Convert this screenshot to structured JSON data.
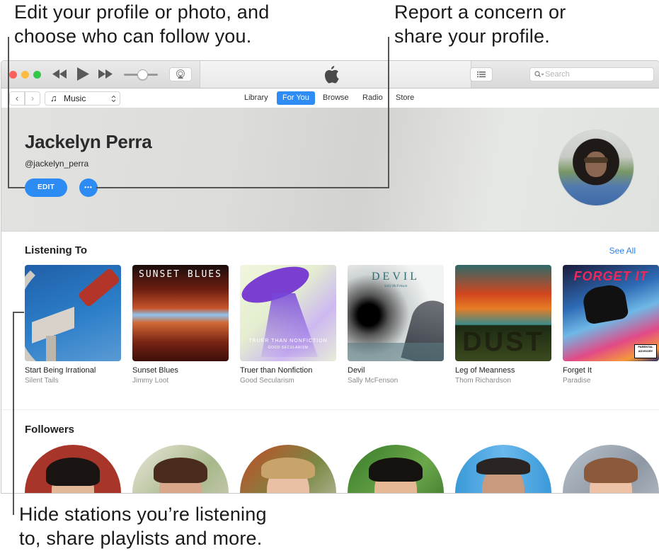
{
  "callouts": {
    "top_left": [
      "Edit your profile or photo, and",
      "choose who can follow you."
    ],
    "top_right": [
      "Report a concern or",
      "share your profile."
    ],
    "bottom": [
      "Hide stations you’re listening",
      "to, share playlists and more."
    ]
  },
  "toolbar": {
    "rewind_icon": "⏪",
    "play_icon": "▶",
    "forward_icon": "⏩",
    "volume_level": 0.55,
    "list_icon": "☰",
    "search_icon": "⌕",
    "search_placeholder": "Search",
    "apple_logo": ""
  },
  "navbar": {
    "back_icon": "‹",
    "forward_icon": "›",
    "source_icon": "♫",
    "source_label": "Music",
    "source_chevron": "⬍",
    "tabs": [
      {
        "label": "Library",
        "active": false
      },
      {
        "label": "For You",
        "active": true
      },
      {
        "label": "Browse",
        "active": false
      },
      {
        "label": "Radio",
        "active": false
      },
      {
        "label": "Store",
        "active": false
      }
    ]
  },
  "profile": {
    "name": "Jackelyn Perra",
    "handle": "@jackelyn_perra",
    "edit_label": "EDIT",
    "more_label": "•••"
  },
  "listening": {
    "title": "Listening To",
    "see_all": "See All",
    "albums": [
      {
        "title": "Start Being Irrational",
        "artist": "Silent Tails"
      },
      {
        "title": "Sunset Blues",
        "artist": "Jimmy Loot",
        "cover_text": "SUNSET BLUES"
      },
      {
        "title": "Truer than Nonfiction",
        "artist": "Good Secularism",
        "cover_text": "TRUER THAN NONFICTION",
        "cover_sub": "GOOD SECULARISM"
      },
      {
        "title": "Devil",
        "artist": "Sally McFenson",
        "cover_text": "DEVIL",
        "cover_sub": "Sally McFenson"
      },
      {
        "title": "Leg of Meanness",
        "artist": "Thom Richardson",
        "cover_text": "DUST"
      },
      {
        "title": "Forget It",
        "artist": "Paradise",
        "cover_text": "FORGET IT",
        "badge": "PARENTAL ADVISORY"
      }
    ]
  },
  "followers": {
    "title": "Followers",
    "count_visible": 6
  },
  "colors": {
    "accent": "#2d8bf4",
    "link": "#2d7fe6"
  }
}
